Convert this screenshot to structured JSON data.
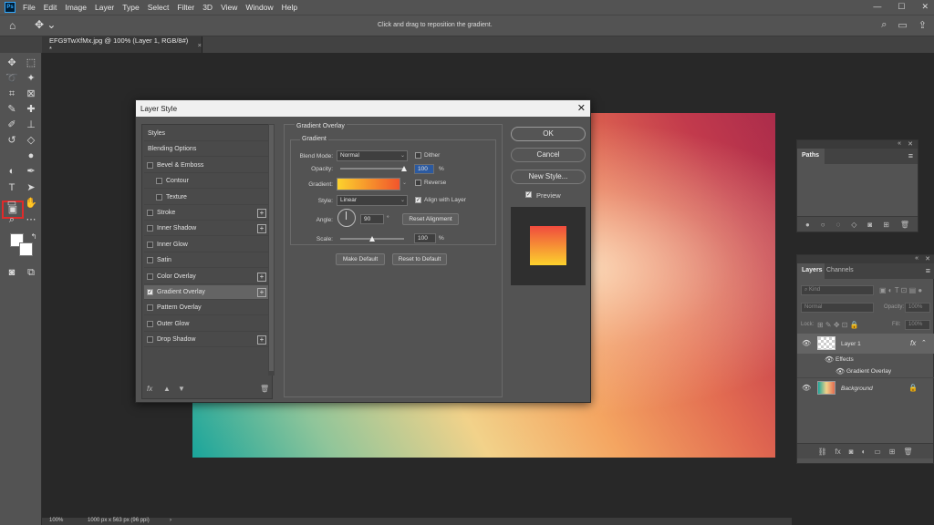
{
  "menubar": {
    "logo": "Ps",
    "items": [
      "File",
      "Edit",
      "Image",
      "Layer",
      "Type",
      "Select",
      "Filter",
      "3D",
      "View",
      "Window",
      "Help"
    ],
    "minimize": "—",
    "maximize": "☐",
    "close": "✕"
  },
  "optionsbar": {
    "hint": "Click and drag to reposition the gradient."
  },
  "document_tab": {
    "title": "EFG9TwXfMx.jpg @ 100% (Layer 1, RGB/8#) *",
    "close": "×"
  },
  "status": {
    "zoom": "100%",
    "size": "1000 px x 563 px (96 ppi)",
    "arrow": "›"
  },
  "dialog": {
    "title": "Layer Style",
    "close": "✕",
    "styles_list": [
      {
        "label": "Styles",
        "check": false,
        "plus": false
      },
      {
        "label": "Blending Options",
        "check": false,
        "plus": false
      },
      {
        "label": "Bevel & Emboss",
        "check": true,
        "checked": false,
        "plus": false
      },
      {
        "label": "Contour",
        "check": true,
        "checked": false,
        "plus": false,
        "indent": true
      },
      {
        "label": "Texture",
        "check": true,
        "checked": false,
        "plus": false,
        "indent": true
      },
      {
        "label": "Stroke",
        "check": true,
        "checked": false,
        "plus": true
      },
      {
        "label": "Inner Shadow",
        "check": true,
        "checked": false,
        "plus": true
      },
      {
        "label": "Inner Glow",
        "check": true,
        "checked": false,
        "plus": false
      },
      {
        "label": "Satin",
        "check": true,
        "checked": false,
        "plus": false
      },
      {
        "label": "Color Overlay",
        "check": true,
        "checked": false,
        "plus": true
      },
      {
        "label": "Gradient Overlay",
        "check": true,
        "checked": true,
        "plus": true,
        "selected": true
      },
      {
        "label": "Pattern Overlay",
        "check": true,
        "checked": false,
        "plus": false
      },
      {
        "label": "Outer Glow",
        "check": true,
        "checked": false,
        "plus": false
      },
      {
        "label": "Drop Shadow",
        "check": true,
        "checked": false,
        "plus": true
      }
    ],
    "footer_icons": {
      "fx": "fx",
      "up": "▲",
      "down": "▼",
      "trash": "🗑"
    },
    "section_title": "Gradient Overlay",
    "group_title": "Gradient",
    "blend_mode_label": "Blend Mode:",
    "blend_mode_value": "Normal",
    "dither_label": "Dither",
    "opacity_label": "Opacity:",
    "opacity_value": "100",
    "opacity_unit": "%",
    "opacity_level": 1.0,
    "gradient_label": "Gradient:",
    "reverse_label": "Reverse",
    "style_label": "Style:",
    "style_value": "Linear",
    "align_label": "Align with Layer",
    "angle_label": "Angle:",
    "angle_value": "90",
    "angle_unit": "°",
    "reset_alignment": "Reset Alignment",
    "scale_label": "Scale:",
    "scale_value": "100",
    "scale_unit": "%",
    "scale_level": 0.5,
    "make_default": "Make Default",
    "reset_default": "Reset to Default",
    "ok": "OK",
    "cancel": "Cancel",
    "new_style": "New Style...",
    "preview_label": "Preview",
    "gradient_colors": [
      "#fcd22d",
      "#f1552c"
    ]
  },
  "paths_panel": {
    "tab": "Paths",
    "collapse": "«",
    "close": "✕",
    "menu": "≡"
  },
  "layers_panel": {
    "tab_layers": "Layers",
    "tab_channels": "Channels",
    "collapse": "«",
    "close": "✕",
    "menu": "≡",
    "kind_placeholder": "Kind",
    "blend": "Normal",
    "opacity_label": "Opacity:",
    "opacity_value": "100%",
    "lock_label": "Lock:",
    "fill_label": "Fill:",
    "fill_value": "100%",
    "layer1_name": "Layer 1",
    "fx_badge": "fx",
    "effects_label": "Effects",
    "gradient_overlay_label": "Gradient Overlay",
    "background_name": "Background"
  }
}
